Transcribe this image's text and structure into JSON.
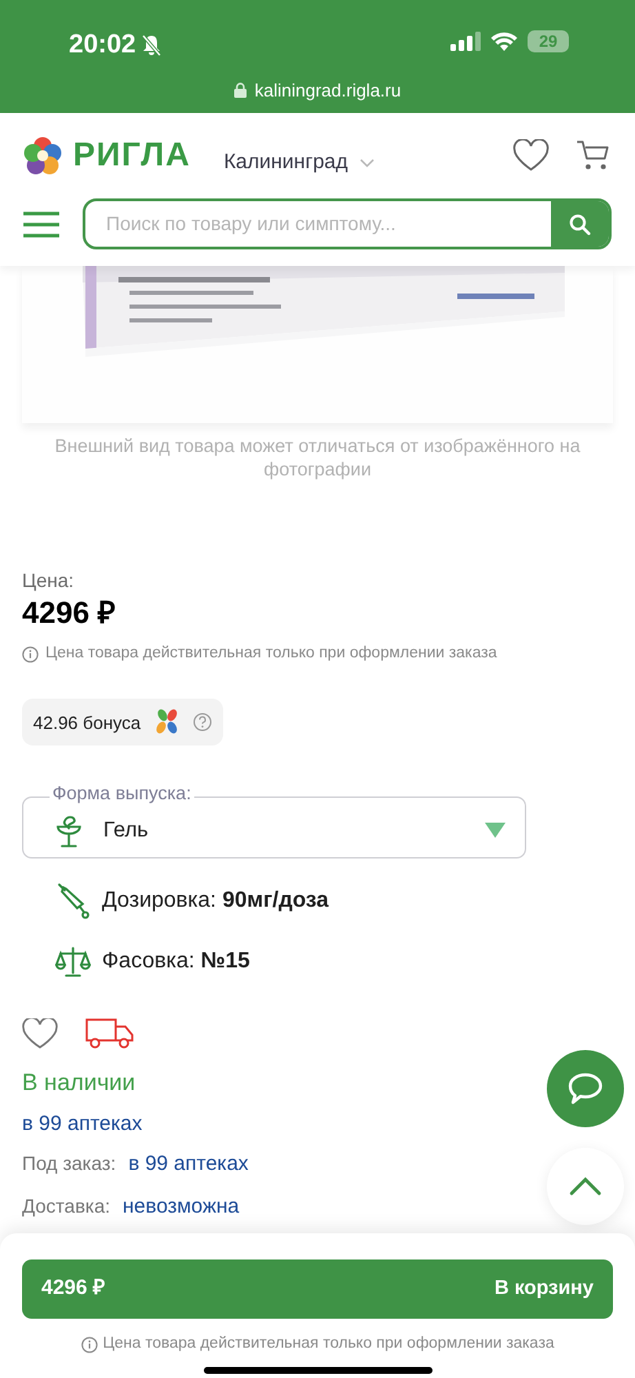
{
  "status_bar": {
    "time": "20:02",
    "battery": "29"
  },
  "browser": {
    "url": "kaliningrad.rigla.ru"
  },
  "header": {
    "brand": "РИГЛА",
    "city": "Калининград",
    "search_placeholder": "Поиск по товару или симптому..."
  },
  "image_caption": "Внешний вид товара может отличаться от изображённого на фотографии",
  "price": {
    "label": "Цена:",
    "value": "4296 ₽",
    "note": "Цена товара действительная только при оформлении заказа"
  },
  "bonus": {
    "text": "42.96 бонуса"
  },
  "form_select": {
    "label": "Форма выпуска:",
    "value": "Гель"
  },
  "specs": [
    {
      "kind": "dosage",
      "text": "Дозировка: **90мг/доза**"
    },
    {
      "kind": "package",
      "text": "Фасовка: **№15**"
    }
  ],
  "availability": {
    "status": "В наличии",
    "stores": "в 99 аптеках"
  },
  "order": {
    "label": "Под заказ:",
    "value": "в 99 аптеках"
  },
  "delivery": {
    "label": "Доставка:",
    "value": "невозможна"
  },
  "cart_bar": {
    "price": "4296 ₽",
    "button": "В корзину",
    "note": "Цена товара действительная только при оформлении заказа"
  }
}
